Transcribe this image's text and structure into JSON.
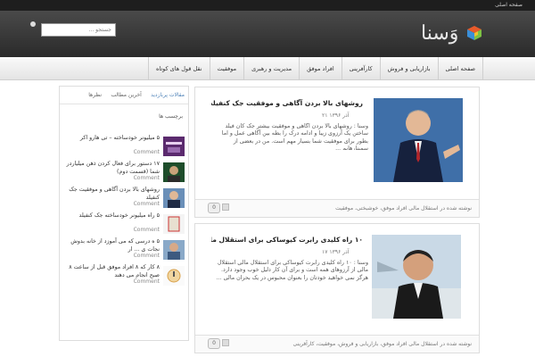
{
  "topbar": {
    "home_label": "صفحه اصلی"
  },
  "header": {
    "logo_text": "وَسنا",
    "search": {
      "value": "جستجو ..."
    }
  },
  "nav": {
    "items": [
      "صفحه اصلی",
      "بازاریابی و فروش",
      "کارآفرینی",
      "افراد موفق",
      "مدیریت و رهبری",
      "موفقیت",
      "نقل قول های کوتاه"
    ]
  },
  "sidebar": {
    "tabs": [
      "مقالات پربازدید",
      "آخرین مطالب",
      "نظرها"
    ],
    "section_title": "برچسب ها",
    "items": [
      {
        "title": "۵ میلیونر خودساخته – تی هارو اکر",
        "comments": "Comment"
      },
      {
        "title": "۱۷ دستور برای فعال کردن ذهن میلیاردر شما (قسمت دوم)",
        "comments": "Comment"
      },
      {
        "title": "روشهای بالا بردن آگاهی و موفقیت جک کنفیلد",
        "comments": "Comment"
      },
      {
        "title": "۵ راه میلیونر خودساخته جک کنفیلد",
        "comments": "Comment"
      },
      {
        "title": "۵ ه درسی که می آموزد از خانه بدوش نجات ی ... ار",
        "comments": "Comment"
      },
      {
        "title": "۸ کار که ۸ افراد موفق قبل از ساعت ۸ صبح انجام می دهند",
        "comments": "Comment"
      }
    ]
  },
  "posts": [
    {
      "title": "روشهای بالا بردن آگاهی و موفقیت جک کنفیلد",
      "date": "۲۱ آذر ۱۳۹۶",
      "body": "وسنا : روشهای بالا بردن آگاهی و موفقیت بیشتر جک کان فیلد ساختن یک آرزوی زیبا و ادامه درک را بطه بین آگاهی عمل و اما بطور برای موفقیت شما بسیار مهم است. من در بعضی از سمینارهایم ...",
      "footer": "نوشته شده در استقلال مالی افراد موفق، خوشبختی، موفقیت"
    },
    {
      "title": "۱۰ راه کلیدی رابرت کیوساکی برای استقلال مالی",
      "date": "۱۷ آذر ۱۳۹۶",
      "body": "وسنا : ۱۰ راه کلیدی رابرت کیوساکی برای استقلال مالی استقلال مالی از آرزوهای همه است و برای آن کار دلیل خوب وجود دارد. هرگز نمی خواهید خودتان را بعنوان محبوس در یک بحران مالی ...",
      "footer": "نوشته شده در استقلال مالی افراد موفق، بازاریابی و فروش، موفقیت، کارآفرینی"
    }
  ],
  "colors": {
    "accent": "#4a7fb6",
    "header_dark": "#2a2a2a",
    "nav_bg": "#eeeeee"
  }
}
